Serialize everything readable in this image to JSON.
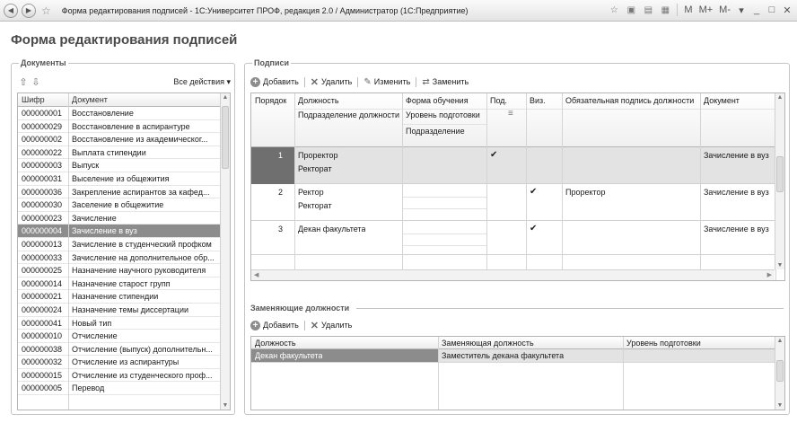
{
  "window": {
    "title": "Форма редактирования подписей - 1С:Университет ПРОФ, редакция 2.0 / Администратор  (1С:Предприятие)",
    "nav_back_icon": "back-arrow-icon",
    "nav_forward_icon": "forward-arrow-icon",
    "fav_icon": "star-icon",
    "memory_buttons": [
      "M",
      "M+",
      "M-"
    ]
  },
  "page_title": "Форма редактирования подписей",
  "documents": {
    "legend": "Документы",
    "all_actions": "Все действия ▾",
    "headers": {
      "code": "Шифр",
      "name": "Документ"
    },
    "rows": [
      {
        "code": "000000001",
        "name": "Восстановление"
      },
      {
        "code": "000000029",
        "name": "Восстановление в аспирантуре"
      },
      {
        "code": "000000002",
        "name": "Восстановление из академическог..."
      },
      {
        "code": "000000022",
        "name": "Выплата стипендии"
      },
      {
        "code": "000000003",
        "name": "Выпуск"
      },
      {
        "code": "000000031",
        "name": "Выселение из общежития"
      },
      {
        "code": "000000036",
        "name": "Закрепление аспирантов за кафед..."
      },
      {
        "code": "000000030",
        "name": "Заселение в общежитие"
      },
      {
        "code": "000000023",
        "name": "Зачисление"
      },
      {
        "code": "000000004",
        "name": "Зачисление в вуз",
        "selected": true
      },
      {
        "code": "000000013",
        "name": "Зачисление в студенческий профком"
      },
      {
        "code": "000000033",
        "name": "Зачисление на дополнительное обр..."
      },
      {
        "code": "000000025",
        "name": "Назначение научного руководителя"
      },
      {
        "code": "000000014",
        "name": "Назначение старост групп"
      },
      {
        "code": "000000021",
        "name": "Назначение стипендии"
      },
      {
        "code": "000000024",
        "name": "Назначение темы диссертации"
      },
      {
        "code": "000000041",
        "name": "Новый тип"
      },
      {
        "code": "000000010",
        "name": "Отчисление"
      },
      {
        "code": "000000038",
        "name": "Отчисление (выпуск) дополнительн..."
      },
      {
        "code": "000000032",
        "name": "Отчисление из аспирантуры"
      },
      {
        "code": "000000015",
        "name": "Отчисление из студенческого проф..."
      },
      {
        "code": "000000005",
        "name": "Перевод"
      }
    ]
  },
  "signatures": {
    "legend": "Подписи",
    "toolbar": {
      "add": "Добавить",
      "delete": "Удалить",
      "edit": "Изменить",
      "replace": "Заменить"
    },
    "headers": {
      "order": "Порядок",
      "position": "Должность",
      "position_sub": "Подразделение должности",
      "study_form": "Форма обучения",
      "level": "Уровень подготовки",
      "department": "Подразделение",
      "sign": "Под.",
      "visa": "Виз.",
      "required": "Обязательная подпись должности",
      "document": "Документ"
    },
    "rows": [
      {
        "order": "1",
        "position": "Проректор",
        "unit": "Ректорат",
        "sign": "✔",
        "visa": "",
        "required": "",
        "document": "Зачисление в вуз"
      },
      {
        "order": "2",
        "position": "Ректор",
        "unit": "Ректорат",
        "sign": "",
        "visa": "✔",
        "required": "Проректор",
        "document": "Зачисление в вуз"
      },
      {
        "order": "3",
        "position": "Декан факультета",
        "unit": "",
        "sign": "",
        "visa": "✔",
        "required": "",
        "document": "Зачисление в вуз"
      }
    ]
  },
  "replacing": {
    "title": "Заменяющие должности",
    "toolbar": {
      "add": "Добавить",
      "delete": "Удалить"
    },
    "headers": {
      "position": "Должность",
      "replacing": "Заменяющая должность",
      "level": "Уровень подготовки"
    },
    "rows": [
      {
        "position": "Декан факультета",
        "replacing": "Заместитель декана факультета",
        "level": ""
      }
    ]
  }
}
